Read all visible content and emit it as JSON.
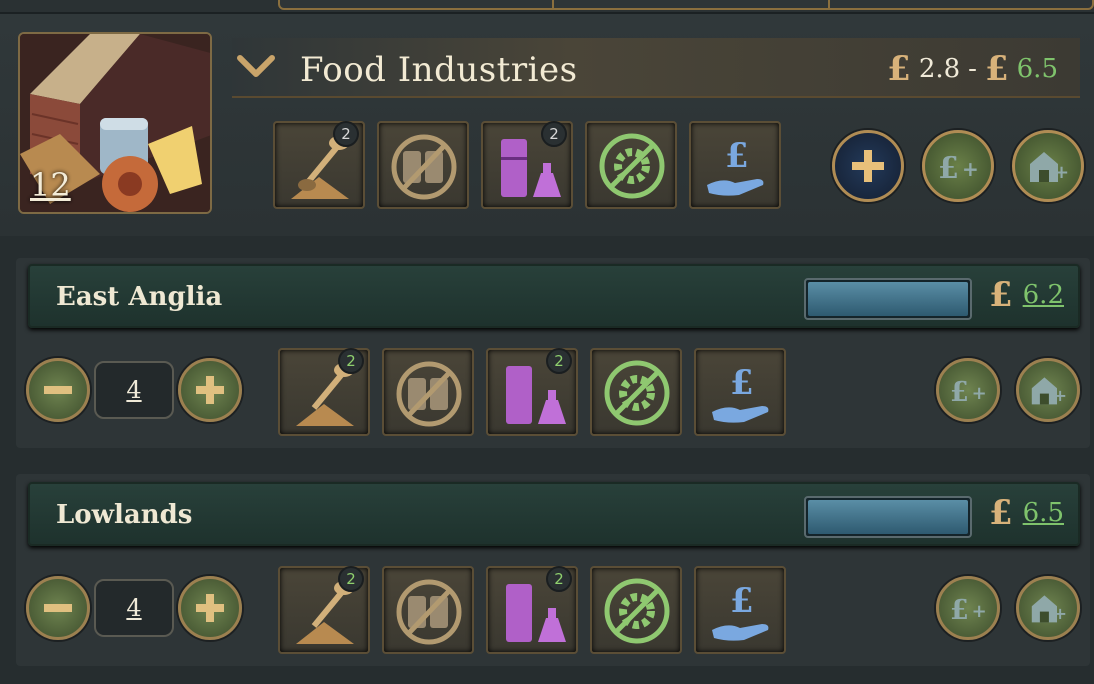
{
  "header": {
    "title": "Food Industries",
    "building_count": "12",
    "range_low": "2.8",
    "range_sep": "-",
    "range_high": "6.5",
    "currency_symbol": "£",
    "slots": [
      {
        "icon": "shovel-grain-icon",
        "badge": "2"
      },
      {
        "icon": "no-canned-goods-icon",
        "badge": ""
      },
      {
        "icon": "distillery-icon",
        "badge": "2"
      },
      {
        "icon": "no-automation-gear-icon",
        "badge": ""
      },
      {
        "icon": "subsidy-hand-pound-icon",
        "badge": ""
      }
    ],
    "buttons": [
      "add-building-icon",
      "invest-pound-plus-icon",
      "build-house-plus-icon"
    ]
  },
  "states": [
    {
      "name": "East Anglia",
      "value": "6.2",
      "progress": 1.0,
      "count": "4",
      "slot_badges": [
        "2",
        "",
        "2",
        "",
        ""
      ]
    },
    {
      "name": "Lowlands",
      "value": "6.5",
      "progress": 1.0,
      "count": "4",
      "slot_badges": [
        "2",
        "",
        "2",
        "",
        ""
      ]
    }
  ],
  "colors": {
    "accent_gold": "#c9a46a",
    "positive_green": "#7fc36c",
    "state_bar": "#1e322d",
    "progress_fill": "#4a7d96"
  }
}
